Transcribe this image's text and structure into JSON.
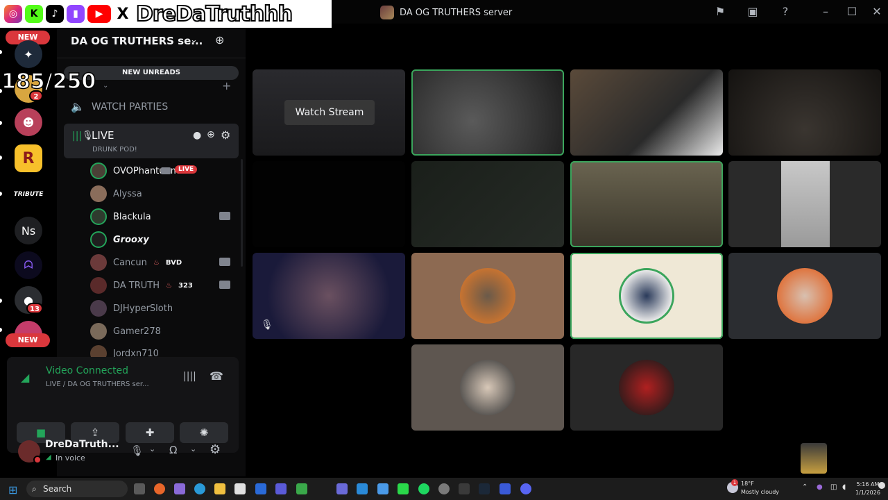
{
  "overlay": {
    "name": "DreDaTruthhh",
    "counter": "185/250"
  },
  "window": {
    "title": "DA OG TRUTHERS server"
  },
  "rail": {
    "new_label_top": "NEW",
    "new_label_bottom": "NEW",
    "badge_1": "2",
    "badge_2": "13",
    "tribute_label": "TRIBUTE",
    "ns_label": "Ns"
  },
  "sidebar": {
    "server_name": "DA OG TRUTHERS se...",
    "new_unreads": "NEW UNREADS",
    "category": "WATCH PARTIES",
    "live_channel": "LIVE",
    "live_status": "DRUNK POD!",
    "users": [
      {
        "name": "OVOPhantuums",
        "badge": "LIVE",
        "video": true,
        "bright": true
      },
      {
        "name": "Alyssa",
        "bright": false
      },
      {
        "name": "Blackula",
        "video": true,
        "bright": true
      },
      {
        "name": "Grooxy",
        "bright": true
      },
      {
        "name": "Cancun",
        "tag": "BVD",
        "video": true,
        "bright": false
      },
      {
        "name": "DA TRUTH",
        "tag": "323",
        "video": true,
        "bright": false
      },
      {
        "name": "DJHyperSloth",
        "bright": false
      },
      {
        "name": "Gamer278",
        "bright": false
      },
      {
        "name": "Jordxn710",
        "bright": false
      }
    ]
  },
  "voice": {
    "title": "Video Connected",
    "subtitle": "LIVE / DA OG TRUTHERS ser..."
  },
  "user_panel": {
    "name": "DreDaTruth...",
    "status": "In voice"
  },
  "stage": {
    "watch_stream": "Watch Stream"
  },
  "taskbar": {
    "search": "Search",
    "weather_temp": "18°F",
    "weather_desc": "Mostly cloudy",
    "weather_badge": "1",
    "time": "5:16 AM",
    "date": "1/1/2026"
  },
  "colors": {
    "accent_green": "#23a55a",
    "danger": "#da373c",
    "speaking_outline": "#3ba55c"
  }
}
